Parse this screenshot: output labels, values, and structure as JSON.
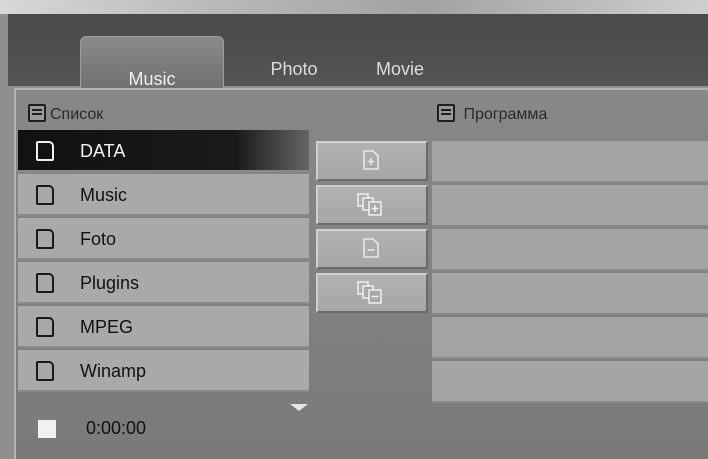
{
  "tabs": {
    "music": "Music",
    "photo": "Photo",
    "movie": "Movie"
  },
  "list": {
    "title": "Список",
    "items": [
      {
        "label": "DATA",
        "selected": true
      },
      {
        "label": "Music"
      },
      {
        "label": "Foto"
      },
      {
        "label": "Plugins"
      },
      {
        "label": "MPEG"
      },
      {
        "label": "Winamp"
      }
    ]
  },
  "program": {
    "title": "Программа"
  },
  "status": {
    "time": "0:00:00"
  },
  "icons": {
    "section": "list-icon",
    "folder": "folder-icon",
    "buttons": [
      "add-file-icon",
      "add-all-icon",
      "remove-file-icon",
      "remove-all-icon"
    ],
    "scroll": "scroll-down-arrow-icon",
    "status": "stop-indicator-icon"
  },
  "colors": {
    "selected_row": "#111111",
    "row": "#a9a9a9",
    "tab_bar": "#4a4a4a"
  }
}
